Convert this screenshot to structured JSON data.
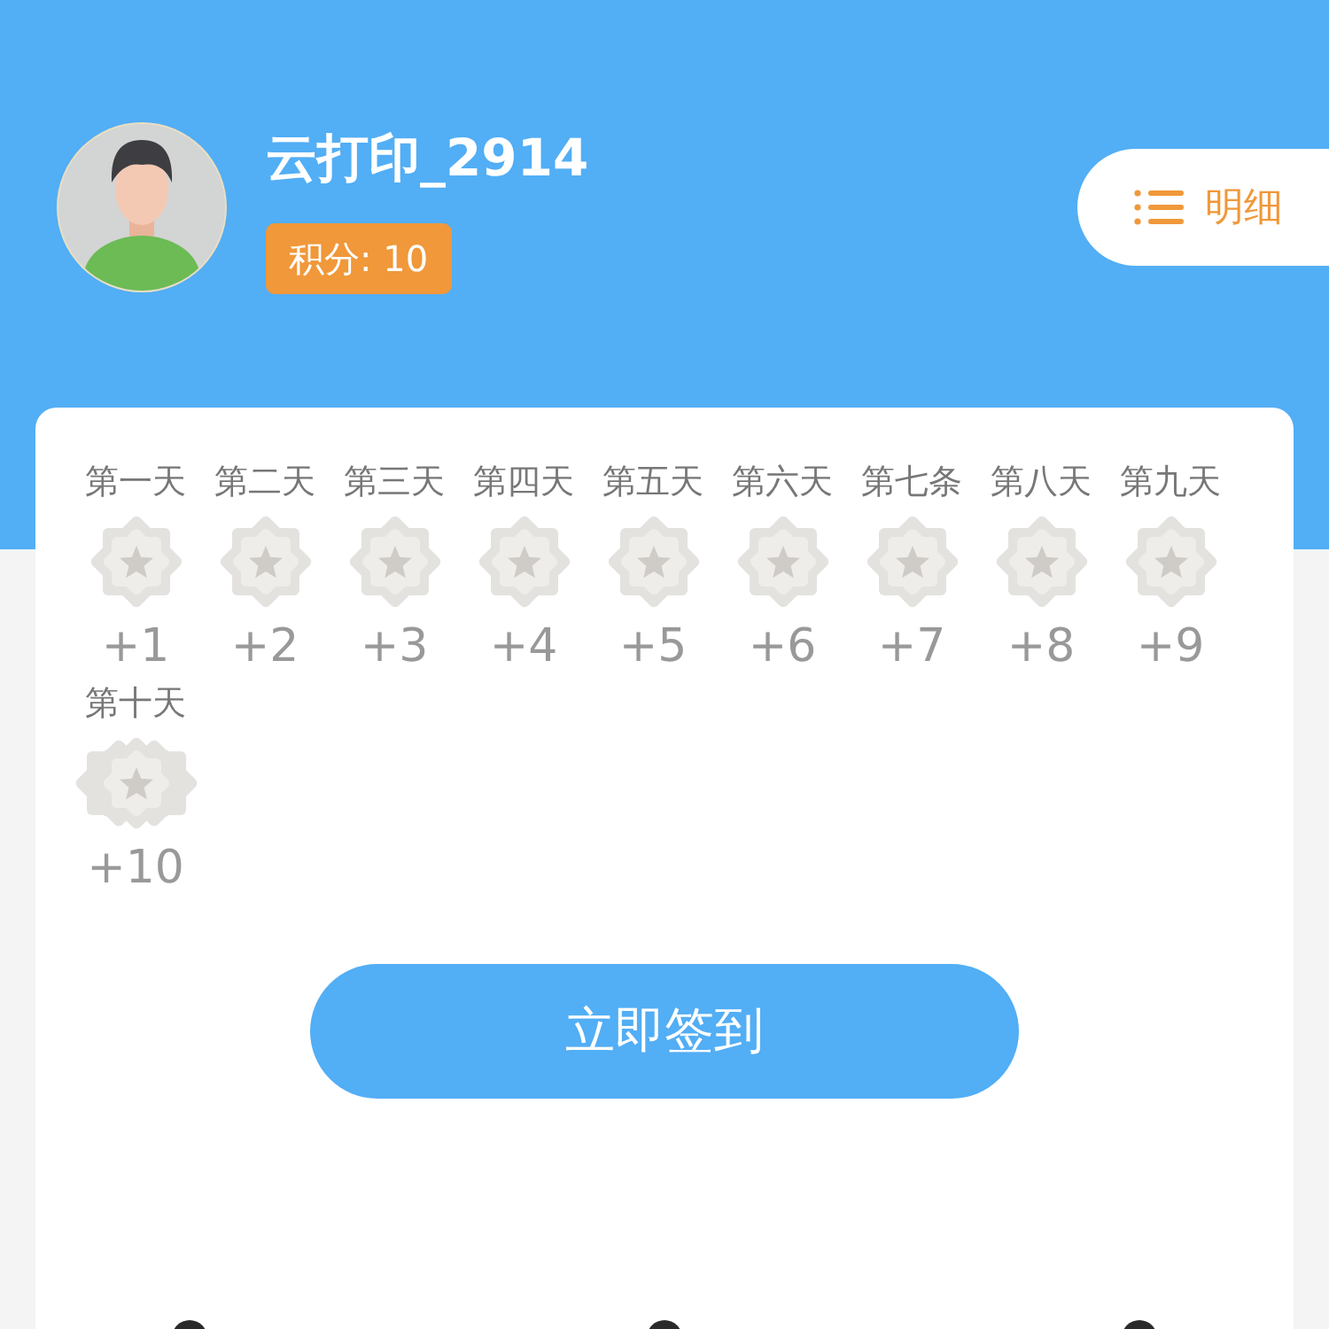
{
  "profile": {
    "username": "云打印_2914",
    "points": "积分: 10"
  },
  "detail_button": {
    "label": "明细"
  },
  "days": [
    {
      "label": "第一天",
      "reward": "+1",
      "kind": "regular",
      "signed": false
    },
    {
      "label": "第二天",
      "reward": "+2",
      "kind": "regular",
      "signed": false
    },
    {
      "label": "第三天",
      "reward": "+3",
      "kind": "regular",
      "signed": false
    },
    {
      "label": "第四天",
      "reward": "+4",
      "kind": "regular",
      "signed": false
    },
    {
      "label": "第五天",
      "reward": "+5",
      "kind": "regular",
      "signed": false
    },
    {
      "label": "第六天",
      "reward": "+6",
      "kind": "regular",
      "signed": false
    },
    {
      "label": "第七条",
      "reward": "+7",
      "kind": "regular",
      "signed": false
    },
    {
      "label": "第八天",
      "reward": "+8",
      "kind": "regular",
      "signed": false
    },
    {
      "label": "第九天",
      "reward": "+9",
      "kind": "regular",
      "signed": false
    },
    {
      "label": "第十天",
      "reward": "+10",
      "kind": "bonus",
      "signed": false
    }
  ],
  "sign_button": {
    "label": "立即签到"
  }
}
